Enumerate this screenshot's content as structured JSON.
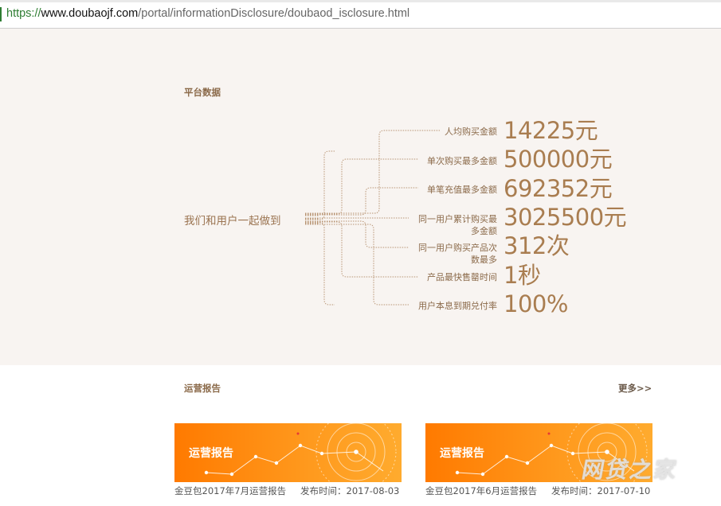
{
  "browser": {
    "url_scheme": "https://",
    "url_host": "www.doubaojf.com",
    "url_path": "/portal/informationDisclosure/doubaod_isclosure.html"
  },
  "platform": {
    "title": "平台数据",
    "hub_text": "我们和用户一起做到",
    "stats": [
      {
        "label_1": "人均购买金额",
        "label_2": "",
        "value": "14225元"
      },
      {
        "label_1": "单次购买最多金额",
        "label_2": "",
        "value": "500000元"
      },
      {
        "label_1": "单笔充值最多金额",
        "label_2": "",
        "value": "692352元"
      },
      {
        "label_1": "同一用户累计购买最",
        "label_2": "多金额",
        "value": "3025500元"
      },
      {
        "label_1": "同一用户购买产品次",
        "label_2": "数最多",
        "value": "312次"
      },
      {
        "label_1": "产品最快售罄时间",
        "label_2": "",
        "value": "1秒"
      },
      {
        "label_1": "用户本息到期兑付率",
        "label_2": "",
        "value": "100%"
      }
    ]
  },
  "reports": {
    "title": "运营报告",
    "more_label": "更多>>",
    "items": [
      {
        "banner_title": "运营报告",
        "name": "金豆包2017年7月运营报告",
        "date": "发布时间：2017-08-03"
      },
      {
        "banner_title": "运营报告",
        "name": "金豆包2017年6月运营报告",
        "date": "发布时间：2017-07-10"
      }
    ]
  },
  "watermark": "网贷之家",
  "colors": {
    "accent": "#a97d50",
    "section_bg": "#f8f4f1",
    "banner_orange": "#ff8a10"
  }
}
